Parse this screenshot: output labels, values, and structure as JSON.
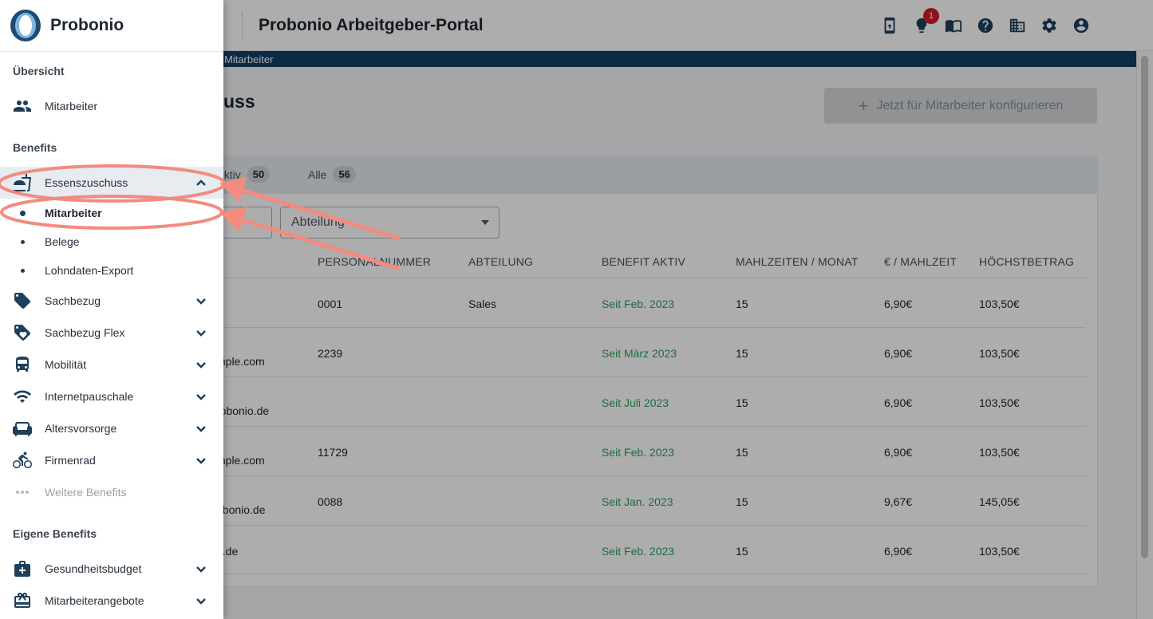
{
  "header": {
    "brand_fragment": "o",
    "portal_title": "Probonio Arbeitgeber-Portal",
    "notification_count": "1",
    "icons": [
      "phone-sync-icon",
      "lightbulb-icon",
      "book-icon",
      "help-icon",
      "building-icon",
      "gear-icon",
      "account-circle-icon"
    ]
  },
  "breadcrumb": {
    "current": "Mitarbeiter"
  },
  "page": {
    "title_fragment": "uss",
    "configure_button": "Jetzt für Mitarbeiter konfigurieren"
  },
  "tabs": [
    {
      "label": "aktiv",
      "count": "50"
    },
    {
      "label": "Alle",
      "count": "56"
    }
  ],
  "filters": {
    "department_placeholder": "Abteilung"
  },
  "table": {
    "headers": [
      "PERSONALNUMMER",
      "ABTEILUNG",
      "BENEFIT AKTIV",
      "MAHLZEITEN / MONAT",
      "€ / MAHLZEIT",
      "HÖCHSTBETRAG"
    ],
    "rows": [
      {
        "email": "",
        "personalnummer": "0001",
        "abteilung": "Sales",
        "benefit": "Seit Feb. 2023",
        "mahlzeiten": "15",
        "preis": "6,90€",
        "hoechst": "103,50€"
      },
      {
        "email": "mple.com",
        "personalnummer": "2239",
        "abteilung": "",
        "benefit": "Seit März 2023",
        "mahlzeiten": "15",
        "preis": "6,90€",
        "hoechst": "103,50€"
      },
      {
        "email": "robonio.de",
        "personalnummer": "",
        "abteilung": "",
        "benefit": "Seit Juli 2023",
        "mahlzeiten": "15",
        "preis": "6,90€",
        "hoechst": "103,50€"
      },
      {
        "email": "mple.com",
        "personalnummer": "11729",
        "abteilung": "",
        "benefit": "Seit Feb. 2023",
        "mahlzeiten": "15",
        "preis": "6,90€",
        "hoechst": "103,50€"
      },
      {
        "email": "obonio.de",
        "personalnummer": "0088",
        "abteilung": "",
        "benefit": "Seit Jan. 2023",
        "mahlzeiten": "15",
        "preis": "9,67€",
        "hoechst": "145,05€"
      },
      {
        "email": "o.de",
        "personalnummer": "",
        "abteilung": "",
        "benefit": "Seit Feb. 2023",
        "mahlzeiten": "15",
        "preis": "6,90€",
        "hoechst": "103,50€"
      }
    ]
  },
  "sidebar": {
    "logo_text": "Probonio",
    "sections": {
      "overview": "Übersicht",
      "benefits": "Benefits",
      "own_benefits": "Eigene Benefits"
    },
    "overview_items": [
      {
        "label": "Mitarbeiter",
        "icon": "people-icon"
      }
    ],
    "benefit_items": [
      {
        "label": "Essenszuschuss",
        "icon": "food-icon",
        "expanded": true
      },
      {
        "label": "Sachbezug",
        "icon": "tag-icon"
      },
      {
        "label": "Sachbezug Flex",
        "icon": "tag-heart-icon"
      },
      {
        "label": "Mobilität",
        "icon": "bus-icon"
      },
      {
        "label": "Internetpauschale",
        "icon": "wifi-icon"
      },
      {
        "label": "Altersvorsorge",
        "icon": "couch-icon"
      },
      {
        "label": "Firmenrad",
        "icon": "bike-icon"
      },
      {
        "label": "Weitere Benefits",
        "icon": "more-dots-icon"
      }
    ],
    "sub_items": [
      {
        "label": "Mitarbeiter",
        "active": true
      },
      {
        "label": "Belege"
      },
      {
        "label": "Lohndaten-Export"
      }
    ],
    "own_benefit_items": [
      {
        "label": "Gesundheitsbudget",
        "icon": "medical-bag-icon"
      },
      {
        "label": "Mitarbeiterangebote",
        "icon": "gift-card-icon"
      }
    ]
  },
  "colors": {
    "brand_navy": "#0f3e66",
    "icon_blue": "#1e3f5c",
    "benefit_green": "#2f9e60",
    "annotation_salmon": "#f38b7e",
    "badge_red": "#d11a2a"
  }
}
